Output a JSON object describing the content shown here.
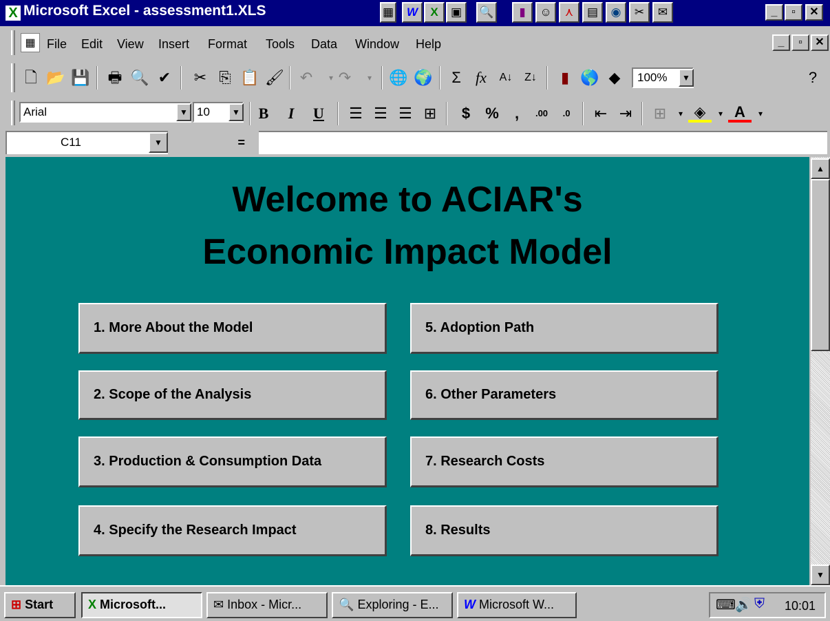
{
  "window": {
    "title": "Microsoft Excel - assessment1.XLS",
    "min": "_",
    "max": "▫",
    "close": "✕"
  },
  "title_toolbar_icons": [
    "office-bar-icon",
    "word-icon",
    "excel-icon",
    "powerpoint-icon",
    "explorer-icon",
    "chart-icon",
    "people-icon",
    "acrobat-icon",
    "calendar-icon",
    "magnifier-icon",
    "scissors-icon",
    "inbox-icon"
  ],
  "menubar": {
    "items": [
      "File",
      "Edit",
      "View",
      "Insert",
      "Format",
      "Tools",
      "Data",
      "Window",
      "Help"
    ]
  },
  "standard_toolbar": {
    "zoom": "100%"
  },
  "formatting_toolbar": {
    "font": "Arial",
    "size": "10",
    "bold": "B",
    "italic": "I",
    "underline": "U",
    "currency": "$",
    "percent": "%",
    "comma": ",",
    "inc_decimal": ".00",
    "dec_decimal": ".0",
    "font_color": "A"
  },
  "formula_bar": {
    "cell_ref": "C11",
    "equals": "=",
    "content": ""
  },
  "sheet": {
    "heading_line1": "Welcome to ACIAR's",
    "heading_line2": "Economic Impact Model",
    "buttons": [
      "1. More About the Model",
      "2. Scope of the Analysis",
      "3. Production & Consumption Data",
      "4. Specify the Research Impact",
      "5. Adoption Path",
      "6. Other Parameters",
      "7. Research Costs",
      "8. Results"
    ]
  },
  "taskbar": {
    "start": "Start",
    "tasks": [
      "Microsoft...",
      "Inbox - Micr...",
      "Exploring - E...",
      "Microsoft W..."
    ],
    "clock": "10:01"
  },
  "colors": {
    "sheet_bg": "#008080",
    "titlebar": "#000080",
    "face": "#c0c0c0"
  }
}
